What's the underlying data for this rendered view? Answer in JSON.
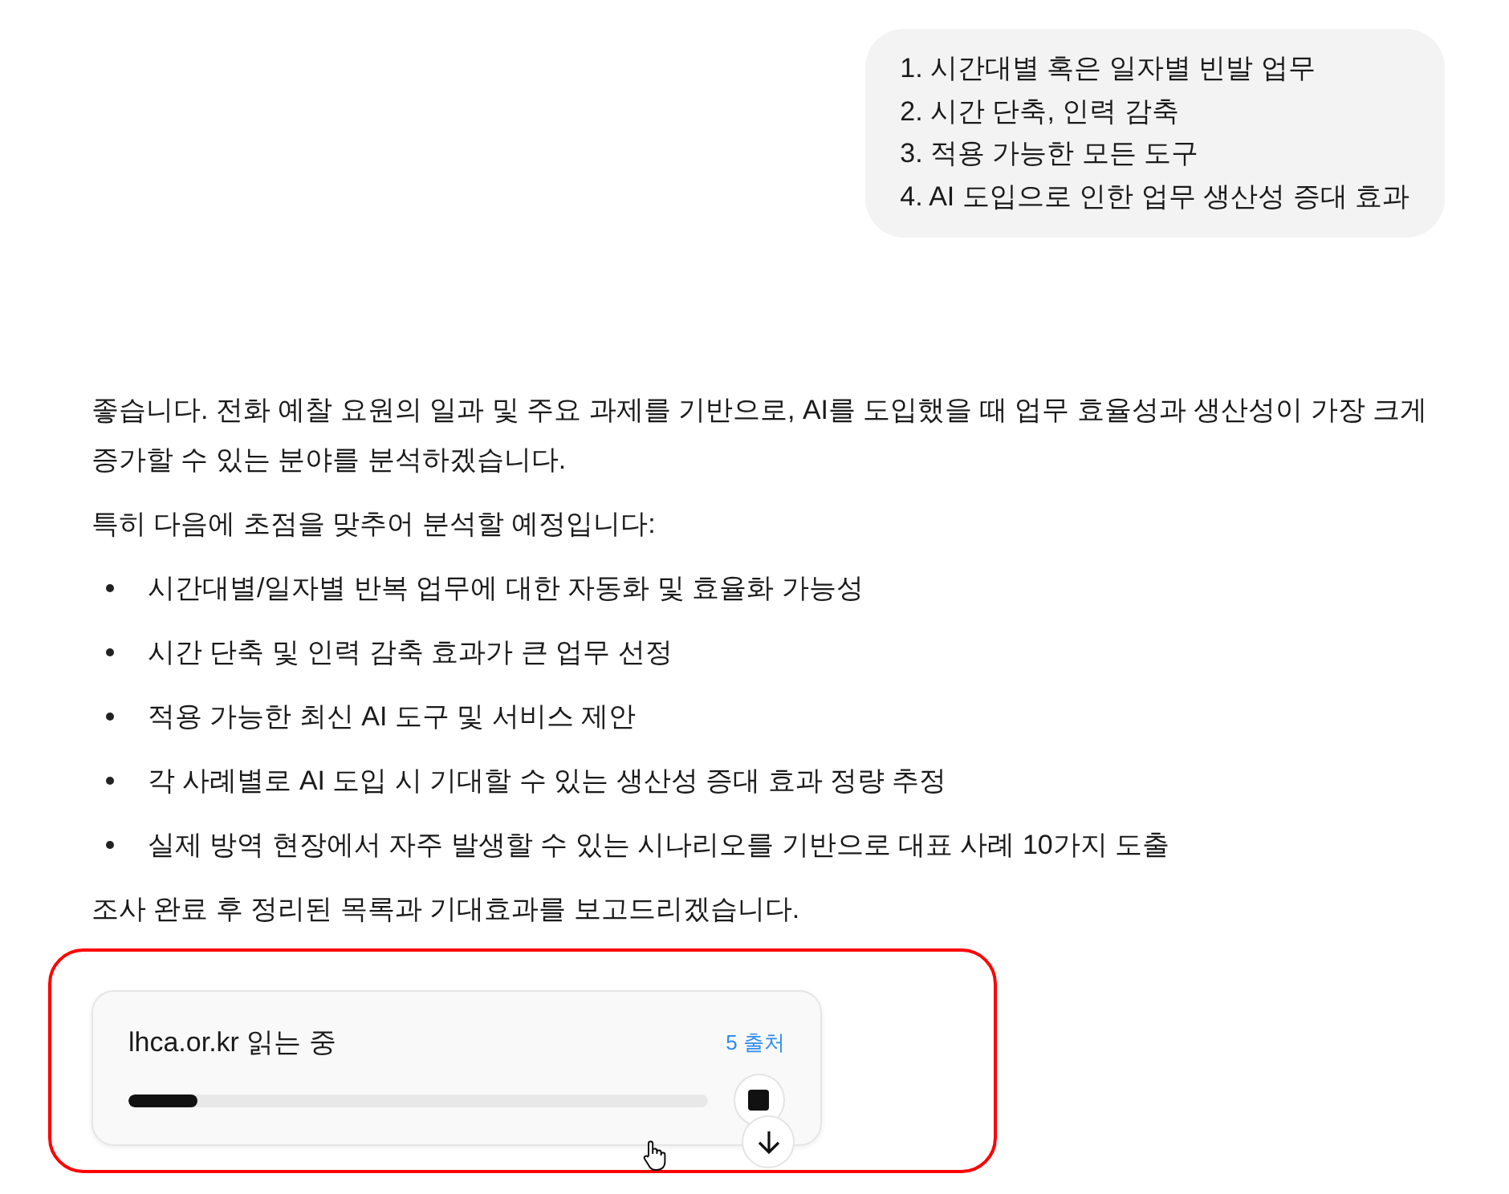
{
  "user_message": {
    "lines": [
      "1. 시간대별 혹은 일자별 빈발 업무",
      "2. 시간 단축, 인력 감축",
      "3. 적용 가능한 모든 도구",
      "4. AI 도입으로 인한 업무 생산성 증대 효과"
    ]
  },
  "assistant_message": {
    "intro": "좋습니다. 전화 예찰 요원의 일과 및 주요 과제를 기반으로, AI를 도입했을 때 업무 효율성과 생산성이 가장 크게 증가할 수 있는 분야를 분석하겠습니다.",
    "focus": "특히 다음에 초점을 맞추어 분석할 예정입니다:",
    "bullets": [
      "시간대별/일자별 반복 업무에 대한 자동화 및 효율화 가능성",
      "시간 단축 및 인력 감축 효과가 큰 업무 선정",
      "적용 가능한 최신 AI 도구 및 서비스 제안",
      "각 사례별로 AI 도입 시 기대할 수 있는 생산성 증대 효과 정량 추정",
      "실제 방역 현장에서 자주 발생할 수 있는 시나리오를 기반으로 대표 사례 10가지 도출"
    ],
    "closing": "조사 완료 후 정리된 목록과 기대효과를 보고드리겠습니다."
  },
  "research_card": {
    "status": "lhca.or.kr 읽는 중",
    "sources": "5 출처",
    "level": 0.12
  }
}
